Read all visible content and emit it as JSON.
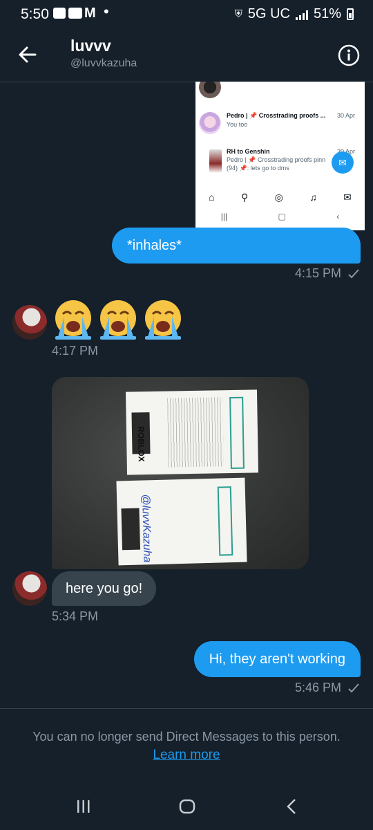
{
  "status_bar": {
    "time": "5:50",
    "network": "5G UC",
    "battery": "51%"
  },
  "header": {
    "title": "luvvv",
    "handle": "@luvvkazuha"
  },
  "embedded_screenshot": {
    "rows": [
      {
        "name": "Pedro | 📌 Crosstrading proofs ...",
        "date": "30 Apr",
        "preview": "You too"
      },
      {
        "name": "RH to Genshin",
        "date": "30 Apr",
        "preview": "Pedro | 📌 Crosstrading proofs pinn",
        "preview2": "(94) 📌: lets go to dms"
      }
    ]
  },
  "messages": {
    "m1": {
      "text": "*inhales*",
      "time": "4:15 PM"
    },
    "m2": {
      "emoji": "😭😭😭",
      "time": "4:17 PM"
    },
    "m3": {
      "text": "here you go!",
      "time": "5:34 PM"
    },
    "m4": {
      "text": "Hi, they aren't working",
      "time": "5:46 PM"
    }
  },
  "photo": {
    "card_brand": "ROBLOX",
    "handwriting": "@luvvKazuha"
  },
  "footer": {
    "notice": "You can no longer send Direct Messages to this person.",
    "learn_more": "Learn more"
  },
  "colors": {
    "background": "#15202b",
    "accent": "#1d9bf0",
    "incoming_bubble": "#38444d"
  }
}
